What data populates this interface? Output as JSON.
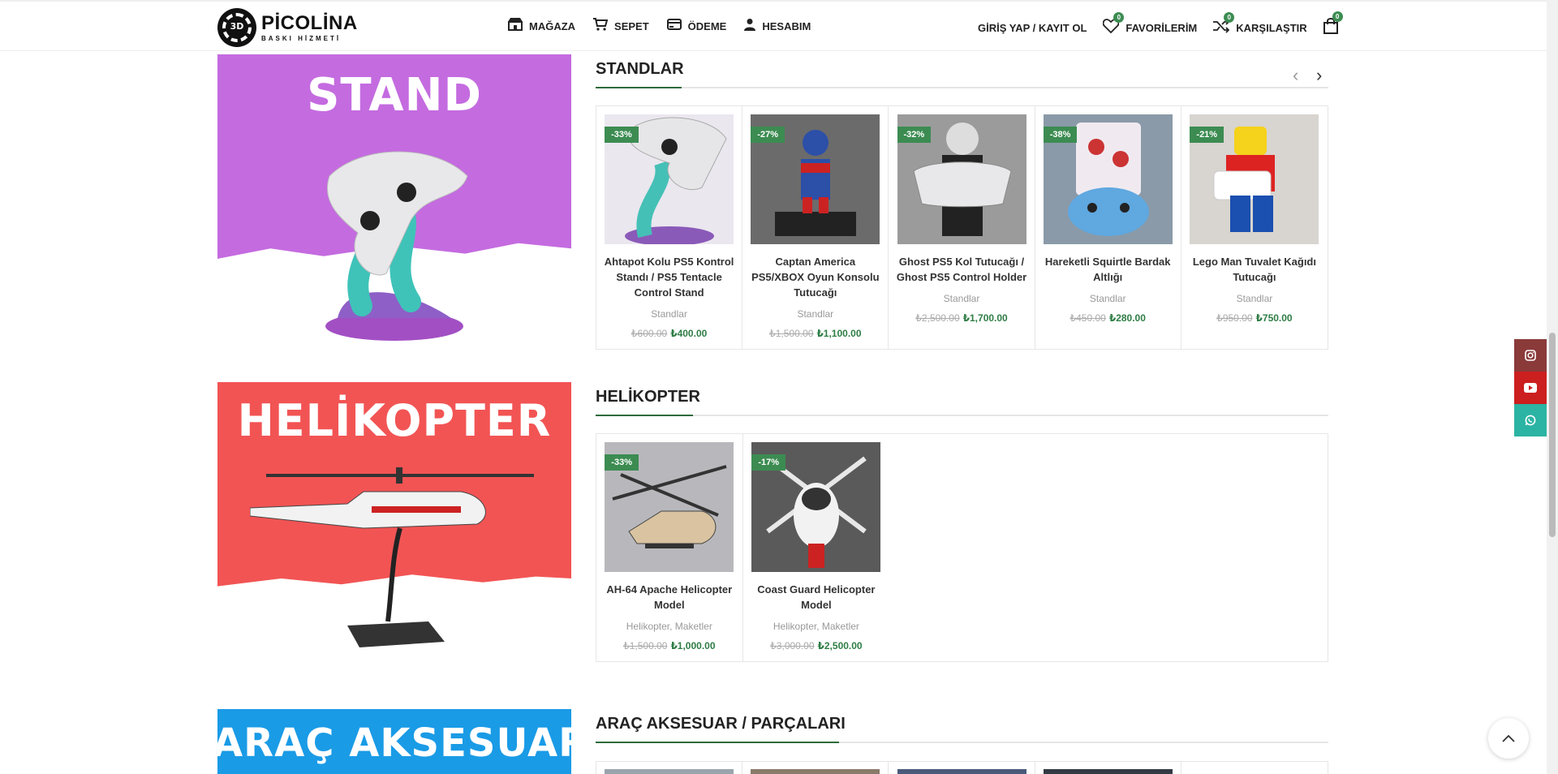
{
  "header": {
    "logo_title": "PİCOLİNA",
    "logo_sub": "BASKI HİZMETİ",
    "logo_mark": "3D",
    "nav": [
      {
        "label": "MAĞAZA",
        "icon": "store-icon"
      },
      {
        "label": "SEPET",
        "icon": "cart-icon"
      },
      {
        "label": "ÖDEME",
        "icon": "card-icon"
      },
      {
        "label": "HESABIM",
        "icon": "user-icon"
      }
    ],
    "login": "GİRİŞ YAP / KAYIT OL",
    "favorites": {
      "label": "FAVORİLERİM",
      "count": "0"
    },
    "compare": {
      "label": "KARŞILAŞTIR",
      "count": "0"
    },
    "bag_count": "0"
  },
  "banners": {
    "stand": "STAND",
    "helikopter": "HELİKOPTER",
    "arac": "ARAÇ AKSESUAR"
  },
  "sections": {
    "standlar": {
      "title": "STANDLAR",
      "products": [
        {
          "discount": "-33%",
          "name": "Ahtapot Kolu PS5 Kontrol Standı / PS5 Tentacle Control Stand",
          "category": "Standlar",
          "old_price": "₺600.00",
          "price": "₺400.00"
        },
        {
          "discount": "-27%",
          "name": "Captan America PS5/XBOX Oyun Konsolu Tutucağı",
          "category": "Standlar",
          "old_price": "₺1,500.00",
          "price": "₺1,100.00"
        },
        {
          "discount": "-32%",
          "name": "Ghost PS5 Kol Tutucağı / Ghost PS5 Control Holder",
          "category": "Standlar",
          "old_price": "₺2,500.00",
          "price": "₺1,700.00"
        },
        {
          "discount": "-38%",
          "name": "Hareketli Squirtle Bardak Altlığı",
          "category": "Standlar",
          "old_price": "₺450.00",
          "price": "₺280.00"
        },
        {
          "discount": "-21%",
          "name": "Lego Man Tuvalet Kağıdı Tutucağı",
          "category": "Standlar",
          "old_price": "₺950.00",
          "price": "₺750.00"
        }
      ]
    },
    "helikopter": {
      "title": "HELİKOPTER",
      "products": [
        {
          "discount": "-33%",
          "name": "AH-64 Apache Helicopter Model",
          "category": "Helikopter, Maketler",
          "old_price": "₺1,500.00",
          "price": "₺1,000.00"
        },
        {
          "discount": "-17%",
          "name": "Coast Guard Helicopter Model",
          "category": "Helikopter, Maketler",
          "old_price": "₺3,000.00",
          "price": "₺2,500.00"
        }
      ]
    },
    "arac": {
      "title": "ARAÇ AKSESUAR / PARÇALARI"
    }
  },
  "colors": {
    "accent": "#3c8c52",
    "stand_banner": "#c46be0",
    "heli_banner": "#f25454",
    "arac_banner": "#1a9be6",
    "instagram": "#8b3a3a",
    "youtube": "#cc1f1f",
    "whatsapp": "#2bb3a3"
  }
}
